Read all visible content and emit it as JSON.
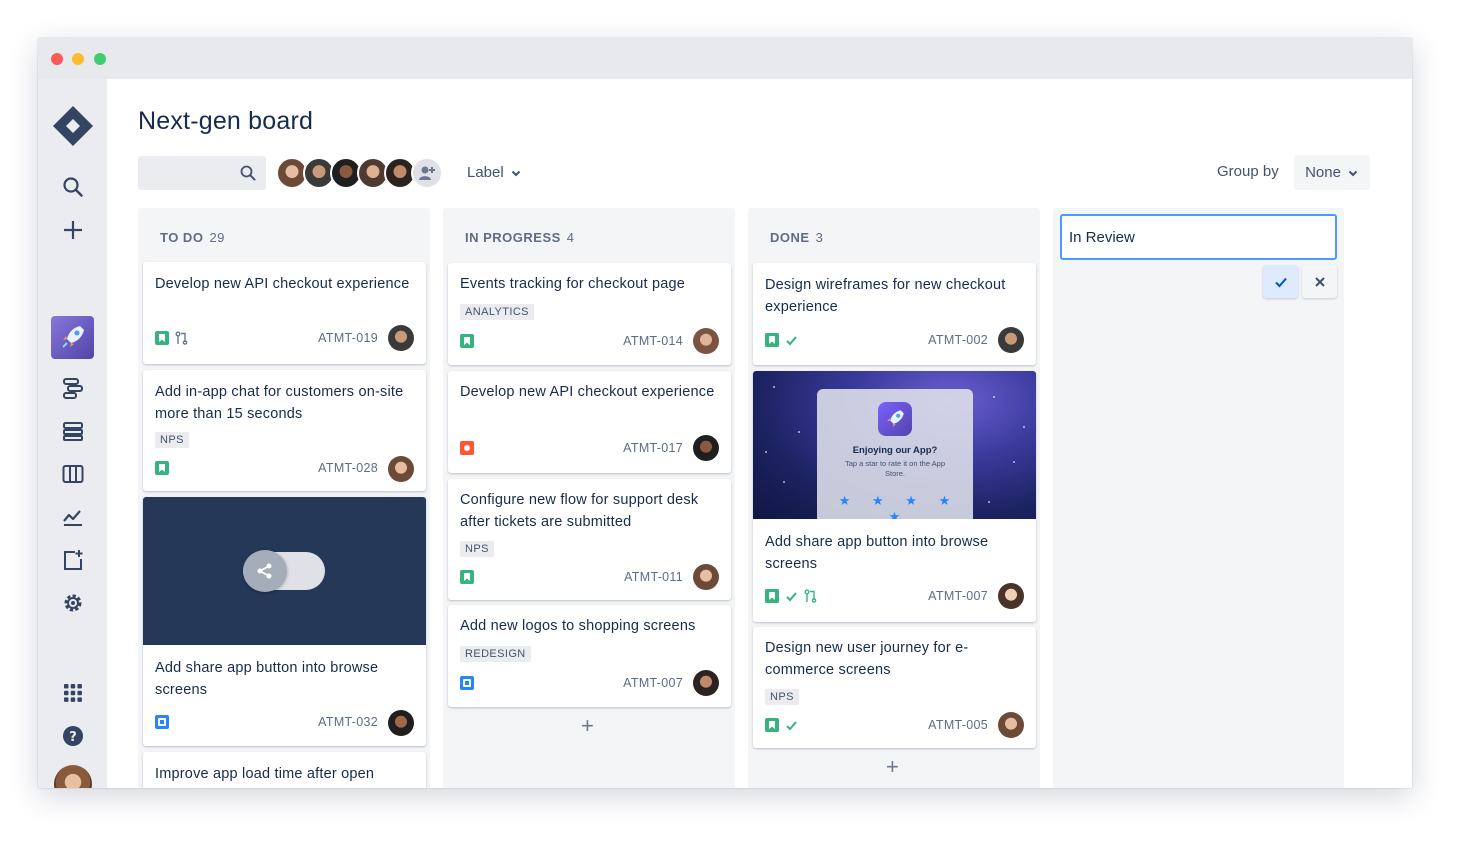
{
  "page": {
    "title": "Next-gen board"
  },
  "toolbar": {
    "search_placeholder": "",
    "filter_label": "Label",
    "group_by_label": "Group by",
    "group_by_value": "None"
  },
  "colors": {
    "accent": "#0052cc",
    "story": "#36b37e",
    "task": "#2684ff",
    "bug": "#ff5630",
    "sidebar": "#ebecf0",
    "column": "#f4f5f7"
  },
  "sidebar": {
    "items": [
      "jira-logo-icon",
      "search-icon",
      "create-icon",
      "project-avatar-icon",
      "roadmap-icon",
      "backlog-icon",
      "board-icon",
      "reports-icon",
      "add-item-icon",
      "settings-icon",
      "app-switcher-icon",
      "help-icon",
      "profile-avatar"
    ]
  },
  "columns": [
    {
      "name": "TO DO",
      "count": "29",
      "cards": [
        {
          "title": "Develop new API checkout experience",
          "key": "ATMT-019",
          "type": "story",
          "extras": [
            "pull-request-icon"
          ]
        },
        {
          "title": "Add in-app chat for customers on-site more than 15 seconds",
          "label": "NPS",
          "key": "ATMT-028",
          "type": "story"
        },
        {
          "title": "Add share app button into browse screens",
          "key": "ATMT-032",
          "type": "task",
          "cover": "share-toggle"
        },
        {
          "title": "Improve app load time after open"
        }
      ]
    },
    {
      "name": "IN PROGRESS",
      "count": "4",
      "cards": [
        {
          "title": "Events tracking for checkout page",
          "label": "ANALYTICS",
          "key": "ATMT-014",
          "type": "story"
        },
        {
          "title": "Develop new API checkout experience",
          "key": "ATMT-017",
          "type": "bug"
        },
        {
          "title": "Configure new flow for support desk after tickets are submitted",
          "label": "NPS",
          "key": "ATMT-011",
          "type": "story"
        },
        {
          "title": "Add new logos to shopping screens",
          "label": "REDESIGN",
          "key": "ATMT-007",
          "type": "task"
        }
      ]
    },
    {
      "name": "DONE",
      "count": "3",
      "cards": [
        {
          "title": "Design wireframes for new checkout experience",
          "key": "ATMT-002",
          "type": "story",
          "extras": [
            "check-icon"
          ]
        },
        {
          "title": "Add share app button into browse screens",
          "key": "ATMT-007",
          "type": "story",
          "extras": [
            "check-icon",
            "pull-request-icon"
          ],
          "cover": {
            "heading": "Enjoying our App?",
            "subtext": "Tap a star to rate it on the App Store.",
            "stars": "★ ★ ★ ★ ★"
          }
        },
        {
          "title": "Design new user journey for e-commerce screens",
          "label": "NPS",
          "key": "ATMT-005",
          "type": "story",
          "extras": [
            "check-icon"
          ]
        }
      ]
    }
  ],
  "new_column": {
    "value": "In Review"
  }
}
